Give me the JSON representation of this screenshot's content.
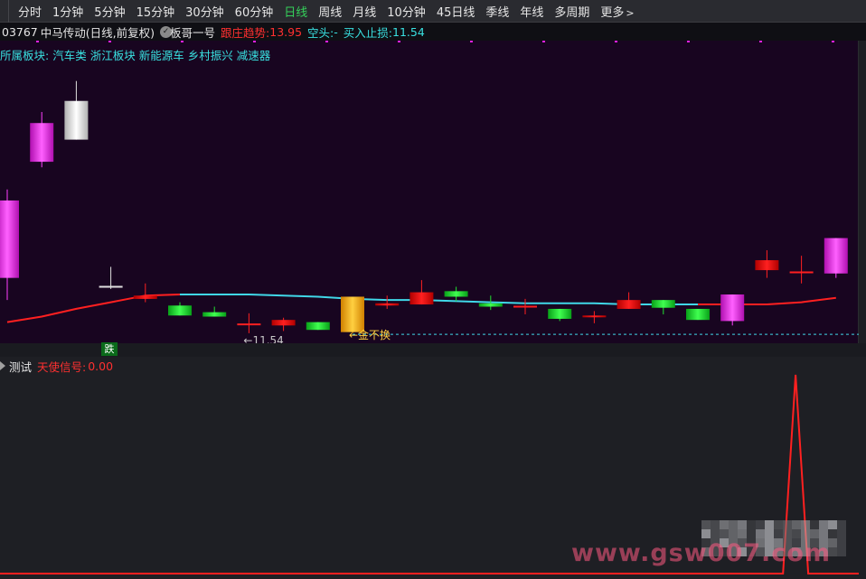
{
  "toolbar": {
    "periods": [
      "分时",
      "1分钟",
      "5分钟",
      "15分钟",
      "30分钟",
      "60分钟",
      "日线",
      "周线",
      "月线",
      "10分钟",
      "45日线",
      "季线",
      "年线",
      "多周期"
    ],
    "active_index": 6,
    "more_label": "更多",
    "more_icon": "chevron-right-icon"
  },
  "info": {
    "stock_code": "03767",
    "stock_name": "中马传动",
    "period_desc": "(日线,前复权)",
    "indicator_name": "板哥一号",
    "trend_label": "跟庄趋势:",
    "trend_value": "13.95",
    "short_label": "空头:",
    "short_value": "-",
    "stoploss_label": "买入止损:",
    "stoploss_value": "11.54"
  },
  "sector": {
    "label": "所属板块:",
    "items": [
      "汽车类",
      "浙江板块",
      "新能源车",
      "乡村振兴",
      "减速器"
    ]
  },
  "annotations": {
    "low_marker": "←11.54",
    "gold_marker": "←金不换",
    "signal_tag": "跌"
  },
  "sub_panel": {
    "name": "测试",
    "signal_label": "天使信号:",
    "signal_value": "0.00"
  },
  "watermark": "www.gsw007.com",
  "colors": {
    "up": "#e00000",
    "down": "#10c020",
    "magenta": "#e020e0",
    "gold": "#ffb000",
    "white_candle": "#f0f0f0",
    "ma_red": "#ff2020",
    "ma_cyan": "#40d8e8",
    "signal_line": "#ff2020",
    "chart_bg": "#180520",
    "sub_bg": "#1e1f24"
  },
  "chart_data": [
    {
      "type": "candlestick",
      "title": "03767 中马传动(日线,前复权)",
      "candles": [
        {
          "o": 13.2,
          "c": 13.9,
          "h": 14.0,
          "l": 13.0,
          "style": "magenta"
        },
        {
          "o": 14.25,
          "c": 14.6,
          "h": 14.7,
          "l": 14.2,
          "style": "magenta"
        },
        {
          "o": 14.45,
          "c": 14.8,
          "h": 14.98,
          "l": 14.45,
          "style": "white"
        },
        {
          "o": 13.12,
          "c": 13.12,
          "h": 13.3,
          "l": 13.1,
          "style": "doji"
        },
        {
          "o": 13.04,
          "c": 13.01,
          "h": 13.15,
          "l": 12.98,
          "style": "red"
        },
        {
          "o": 12.86,
          "c": 12.95,
          "h": 12.98,
          "l": 12.86,
          "style": "green"
        },
        {
          "o": 12.85,
          "c": 12.89,
          "h": 12.94,
          "l": 12.85,
          "style": "green"
        },
        {
          "o": 12.78,
          "c": 12.78,
          "h": 12.88,
          "l": 12.7,
          "style": "doji"
        },
        {
          "o": 12.82,
          "c": 12.77,
          "h": 12.84,
          "l": 12.72,
          "style": "red"
        },
        {
          "o": 12.73,
          "c": 12.8,
          "h": 12.8,
          "l": 12.73,
          "style": "green"
        },
        {
          "o": 12.71,
          "c": 13.03,
          "h": 13.03,
          "l": 12.7,
          "style": "gold"
        },
        {
          "o": 12.97,
          "c": 12.95,
          "h": 13.04,
          "l": 12.92,
          "style": "red"
        },
        {
          "o": 13.07,
          "c": 12.96,
          "h": 13.18,
          "l": 12.96,
          "style": "red"
        },
        {
          "o": 13.03,
          "c": 13.08,
          "h": 13.12,
          "l": 12.99,
          "style": "green"
        },
        {
          "o": 12.94,
          "c": 12.97,
          "h": 13.04,
          "l": 12.91,
          "style": "green"
        },
        {
          "o": 12.94,
          "c": 12.94,
          "h": 13.01,
          "l": 12.87,
          "style": "doji"
        },
        {
          "o": 12.83,
          "c": 12.92,
          "h": 12.92,
          "l": 12.81,
          "style": "green"
        },
        {
          "o": 12.86,
          "c": 12.85,
          "h": 12.9,
          "l": 12.79,
          "style": "red"
        },
        {
          "o": 13.0,
          "c": 12.92,
          "h": 13.07,
          "l": 12.92,
          "style": "red"
        },
        {
          "o": 12.93,
          "c": 13.0,
          "h": 13.0,
          "l": 12.87,
          "style": "green"
        },
        {
          "o": 12.82,
          "c": 12.92,
          "h": 12.92,
          "l": 12.82,
          "style": "green"
        },
        {
          "o": 12.81,
          "c": 13.05,
          "h": 13.05,
          "l": 12.77,
          "style": "magenta"
        },
        {
          "o": 13.36,
          "c": 13.27,
          "h": 13.45,
          "l": 13.2,
          "style": "red"
        },
        {
          "o": 13.25,
          "c": 13.24,
          "h": 13.4,
          "l": 13.15,
          "style": "doji"
        },
        {
          "o": 13.24,
          "c": 13.56,
          "h": 13.56,
          "l": 13.2,
          "style": "magenta"
        }
      ],
      "ma": [
        12.8,
        12.85,
        12.92,
        12.98,
        13.04,
        13.05,
        13.05,
        13.05,
        13.04,
        13.03,
        13.01,
        13.0,
        13.0,
        12.99,
        12.98,
        12.97,
        12.97,
        12.97,
        12.96,
        12.96,
        12.96,
        12.96,
        12.96,
        12.98,
        13.02
      ],
      "ma_cyan_range": [
        5,
        20
      ],
      "ylim": [
        12.65,
        15.1
      ],
      "stop_line": 12.69
    },
    {
      "type": "line",
      "title": "测试",
      "series": [
        {
          "name": "天使信号",
          "values": [
            0,
            0,
            0,
            0,
            0,
            0,
            0,
            0,
            0,
            0,
            0,
            0,
            0,
            0,
            0,
            0,
            0,
            0,
            0,
            0,
            0,
            0,
            0,
            0,
            0,
            0,
            0,
            0,
            0,
            0,
            0,
            0,
            0,
            0,
            0,
            0,
            0,
            0,
            0,
            0,
            0,
            0,
            0,
            0,
            0,
            0,
            0,
            0,
            0,
            0,
            0,
            0,
            0,
            0,
            0,
            0,
            0,
            0,
            0,
            0,
            0,
            0,
            0,
            1,
            0,
            0,
            0,
            0,
            0
          ]
        }
      ],
      "ylim": [
        0,
        1
      ]
    }
  ]
}
